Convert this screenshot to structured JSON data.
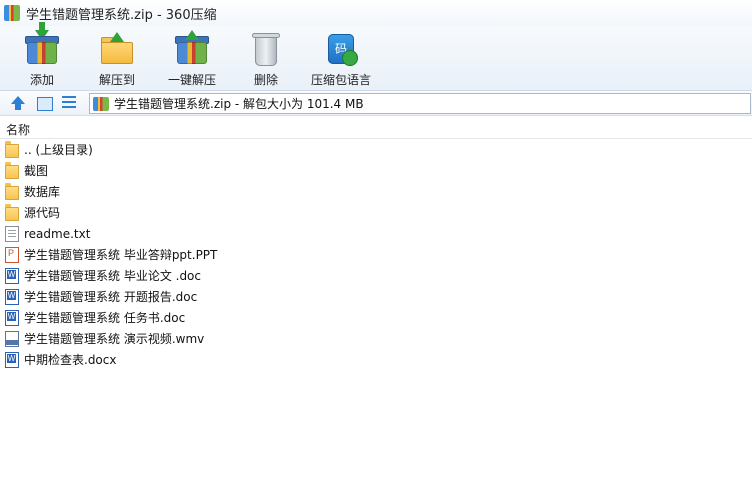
{
  "window": {
    "title": "学生错题管理系统.zip - 360压缩"
  },
  "toolbar": {
    "buttons": [
      {
        "label": "添加",
        "icon": "add-archive-icon"
      },
      {
        "label": "解压到",
        "icon": "extract-to-icon"
      },
      {
        "label": "一键解压",
        "icon": "one-click-extract-icon"
      },
      {
        "label": "删除",
        "icon": "delete-trash-icon"
      },
      {
        "label": "压缩包语言",
        "icon": "archive-language-icon"
      }
    ],
    "lang_glyph": "码"
  },
  "address": {
    "path": "学生错题管理系统.zip - 解包大小为 101.4 MB"
  },
  "list": {
    "column_name": "名称",
    "items": [
      {
        "name": ".. (上级目录)",
        "type": "folder"
      },
      {
        "name": "截图",
        "type": "folder"
      },
      {
        "name": "数据库",
        "type": "folder"
      },
      {
        "name": "源代码",
        "type": "folder"
      },
      {
        "name": "readme.txt",
        "type": "text"
      },
      {
        "name": "学生错题管理系统 毕业答辩ppt.PPT",
        "type": "ppt"
      },
      {
        "name": "学生错题管理系统 毕业论文 .doc",
        "type": "word"
      },
      {
        "name": "学生错题管理系统 开题报告.doc",
        "type": "word"
      },
      {
        "name": "学生错题管理系统 任务书.doc",
        "type": "word"
      },
      {
        "name": "学生错题管理系统 演示视频.wmv",
        "type": "video"
      },
      {
        "name": "中期检查表.docx",
        "type": "word"
      }
    ]
  }
}
